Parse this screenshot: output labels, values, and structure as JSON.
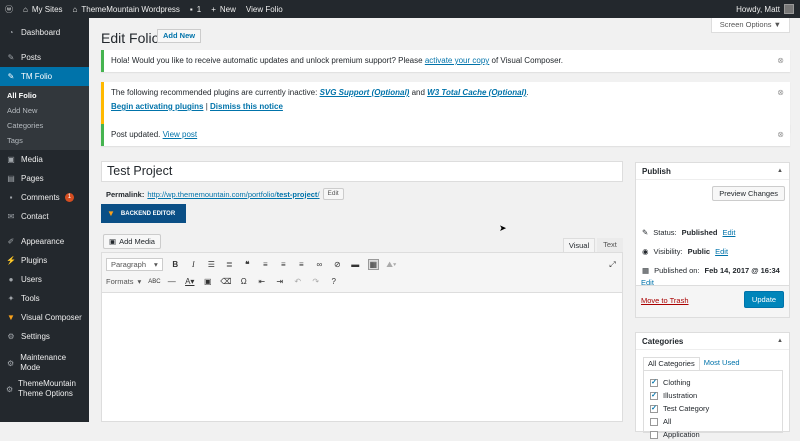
{
  "adminbar": {
    "my_sites": "My Sites",
    "site_name": "ThemeMountain Wordpress",
    "comments_count": "1",
    "new_label": "New",
    "view_label": "View Folio",
    "howdy": "Howdy, Matt"
  },
  "sidebar": {
    "items_top": [
      {
        "label": "Dashboard",
        "icon": "dashboard-icon"
      },
      {
        "label": "Posts",
        "icon": "pin-icon"
      },
      {
        "label": "TM Folio",
        "icon": "pin-icon"
      }
    ],
    "submenu": [
      "All Folio",
      "Add New",
      "Categories",
      "Tags"
    ],
    "items_mid": [
      {
        "label": "Media",
        "icon": "media-icon"
      },
      {
        "label": "Pages",
        "icon": "pages-icon"
      },
      {
        "label": "Comments",
        "icon": "comment-icon",
        "badge": "1"
      },
      {
        "label": "Contact",
        "icon": "mail-icon"
      }
    ],
    "items_bottom": [
      {
        "label": "Appearance",
        "icon": "brush-icon"
      },
      {
        "label": "Plugins",
        "icon": "plugin-icon"
      },
      {
        "label": "Users",
        "icon": "user-icon"
      },
      {
        "label": "Tools",
        "icon": "wrench-icon"
      },
      {
        "label": "Visual Composer",
        "icon": "vc-icon"
      },
      {
        "label": "Settings",
        "icon": "settings-icon"
      }
    ],
    "maintenance_label": "Maintenance Mode",
    "tm_options_label": "ThemeMountain Theme Options"
  },
  "header": {
    "screen_options": "Screen Options ▼",
    "title": "Edit Folio",
    "add_new": "Add New"
  },
  "notices": {
    "vc_text": "Hola! Would you like to receive automatic updates and unlock premium support? Please",
    "vc_link": "activate your copy",
    "vc_tail": "of Visual Composer.",
    "plugins_text": "The following recommended plugins are currently inactive:",
    "plugin1": "SVG Support (Optional)",
    "and": "and",
    "plugin2": "W3 Total Cache (Optional)",
    "dot": ".",
    "begin_link": "Begin activating plugins",
    "pipe": "|",
    "dismiss_link": "Dismiss this notice",
    "updated_text": "Post updated.",
    "view_post": "View post"
  },
  "editor": {
    "title_value": "Test Project",
    "permalink_label": "Permalink:",
    "permalink_base": "http://wp.thememountain.com/portfolio/",
    "permalink_slug": "test-project",
    "permalink_end": "/",
    "edit_btn": "Edit",
    "backend_editor": "BACKEND EDITOR",
    "add_media": "Add Media",
    "tab_visual": "Visual",
    "tab_text": "Text",
    "paragraph": "Paragraph",
    "formats": "Formats"
  },
  "publish": {
    "title": "Publish",
    "preview": "Preview Changes",
    "status_label": "Status:",
    "status_value": "Published",
    "visibility_label": "Visibility:",
    "visibility_value": "Public",
    "published_label": "Published on:",
    "published_value": "Feb 14, 2017 @ 16:34",
    "edit": "Edit",
    "trash": "Move to Trash",
    "update": "Update"
  },
  "categories": {
    "title": "Categories",
    "tab_all": "All Categories",
    "tab_most": "Most Used",
    "items": [
      {
        "label": "Clothing",
        "checked": true
      },
      {
        "label": "Illustration",
        "checked": true
      },
      {
        "label": "Test Category",
        "checked": true
      },
      {
        "label": "All",
        "checked": false
      },
      {
        "label": "Application",
        "checked": false
      }
    ]
  }
}
